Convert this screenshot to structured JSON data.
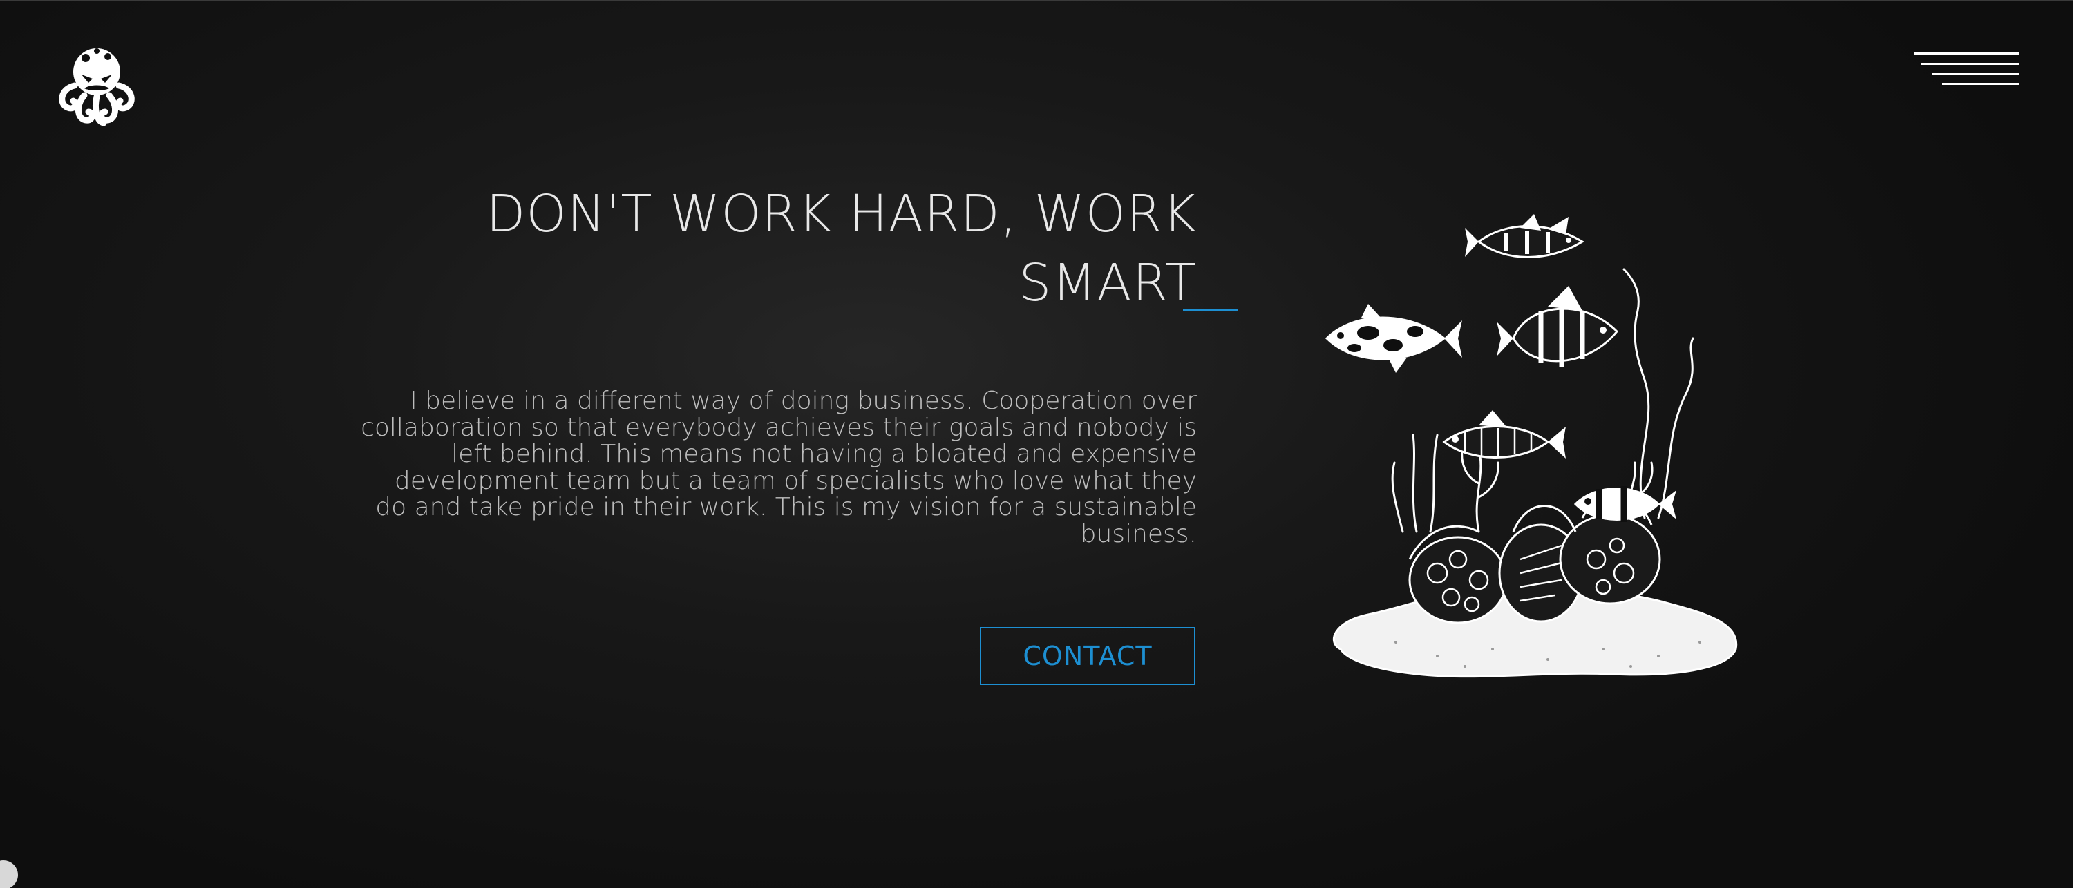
{
  "header": {
    "logo_icon": "octopus-logo-icon",
    "menu_icon": "hamburger-menu-icon"
  },
  "hero": {
    "headline": "DON'T WORK HARD, WORK SMART",
    "intro": "I believe in a different way of doing business. Cooperation over collaboration so that everybody achieves their goals and nobody is left behind. This means not having a bloated and expensive development team but a team of specialists who love what they do and take pride in their work. This is my vision for a sustainable business.",
    "contact_label": "CONTACT",
    "illustration_icon": "coral-reef-fish-illustration"
  },
  "colors": {
    "accent": "#1d8fd2",
    "background": "#161616",
    "text": "#e8e8e8"
  }
}
